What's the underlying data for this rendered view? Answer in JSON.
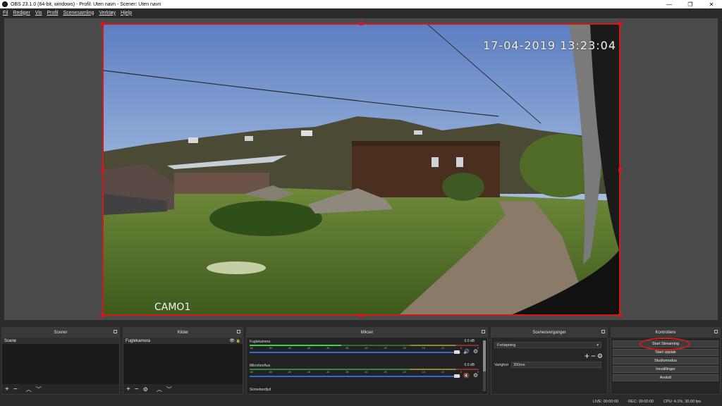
{
  "window": {
    "title": "OBS 23.1.0 (64-bit, windows) - Profil: Uten navn - Scener: Uten navn",
    "minimize": "—",
    "restore": "❐",
    "close": "✕"
  },
  "menu": [
    "Fil",
    "Rediger",
    "Vis",
    "Profil",
    "Scenesamling",
    "Verktøy",
    "Hjelp"
  ],
  "preview": {
    "timestamp": "17-04-2019 13:23:04",
    "camera_label": "CAMO1",
    "selection_color": "#d81818"
  },
  "scenes": {
    "title": "Scener",
    "items": [
      "Scene"
    ]
  },
  "sources": {
    "title": "Kilder",
    "items": [
      "Fuglekamera"
    ]
  },
  "mixer": {
    "title": "Mikser",
    "channels": [
      {
        "name": "Fuglekamera",
        "db": "0.0 dB",
        "muted": false
      },
      {
        "name": "Mikrofon/Aux",
        "db": "0.0 dB",
        "muted": true
      },
      {
        "name": "Skrivebordlyd",
        "db": "",
        "muted": false
      }
    ],
    "ticks": [
      "-60",
      "-55",
      "-50",
      "-45",
      "-40",
      "-35",
      "-30",
      "-25",
      "-20",
      "-15",
      "-10",
      "-5",
      "0"
    ]
  },
  "transitions": {
    "title": "Sceneoverganger",
    "selected": "Forløpning",
    "duration_label": "Varighet",
    "duration_value": "300ms"
  },
  "controls": {
    "title": "Kontrollere",
    "buttons": [
      "Start Streaming",
      "Start opptak",
      "Studiomodus",
      "Innstillinger",
      "Avslutt"
    ]
  },
  "status": {
    "live": "LIVE: 00:00:00",
    "rec": "REC: 00:00:00",
    "cpu": "CPU: 4.1%, 30.00 fps"
  }
}
